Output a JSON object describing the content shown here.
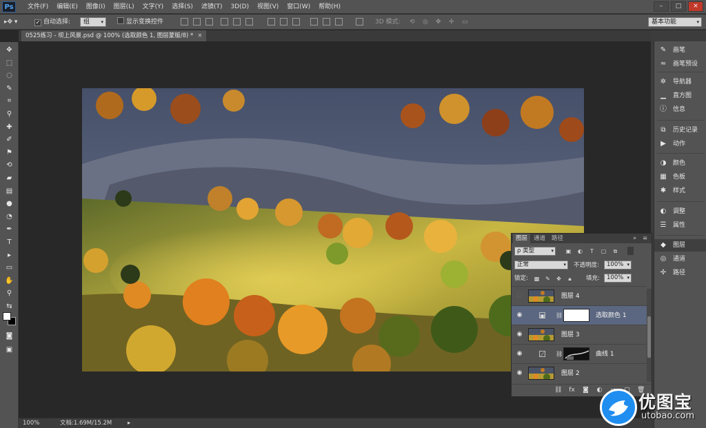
{
  "app": {
    "logo": "Ps"
  },
  "menu": [
    "文件(F)",
    "编辑(E)",
    "图像(I)",
    "图层(L)",
    "文字(Y)",
    "选择(S)",
    "滤镜(T)",
    "3D(D)",
    "视图(V)",
    "窗口(W)",
    "帮助(H)"
  ],
  "window_controls": {
    "minimize": "–",
    "maximize": "□",
    "close": "×"
  },
  "options": {
    "auto_select_label": "自动选择:",
    "auto_select_value": "组",
    "show_transform_label": "显示变换控件",
    "mode3d_label": "3D 模式:",
    "workspace": "基本功能"
  },
  "document": {
    "tab_title": "0525练习 - 坝上风景.psd @ 100% (选取颜色 1, 图层蒙版/8) *",
    "close": "×"
  },
  "status": {
    "zoom": "100%",
    "doc_size": "文档:1.69M/15.2M",
    "arrow": "▸"
  },
  "dock": [
    {
      "label": "画笔",
      "icon": "brush-icon",
      "glyph": "✎"
    },
    {
      "label": "画笔预设",
      "icon": "brush-presets-icon",
      "glyph": "≈"
    },
    {
      "label": "导航器",
      "icon": "navigator-icon",
      "glyph": "✲"
    },
    {
      "label": "直方图",
      "icon": "histogram-icon",
      "glyph": "▁"
    },
    {
      "label": "信息",
      "icon": "info-icon",
      "glyph": "ⓘ"
    },
    {
      "label": "历史记录",
      "icon": "history-icon",
      "glyph": "⧉"
    },
    {
      "label": "动作",
      "icon": "actions-icon",
      "glyph": "▶"
    },
    {
      "label": "颜色",
      "icon": "color-icon",
      "glyph": "◑"
    },
    {
      "label": "色板",
      "icon": "swatches-icon",
      "glyph": "▦"
    },
    {
      "label": "样式",
      "icon": "styles-icon",
      "glyph": "✱"
    },
    {
      "label": "调整",
      "icon": "adjustments-icon",
      "glyph": "◐"
    },
    {
      "label": "属性",
      "icon": "properties-icon",
      "glyph": "☰"
    },
    {
      "label": "图层",
      "icon": "layers-icon",
      "glyph": "◆"
    },
    {
      "label": "通道",
      "icon": "channels-icon",
      "glyph": "◎"
    },
    {
      "label": "路径",
      "icon": "paths-icon",
      "glyph": "✢"
    }
  ],
  "layers_panel": {
    "tabs": [
      "图层",
      "通道",
      "路径"
    ],
    "filter": "ρ 类型",
    "blend_mode": "正常",
    "opacity_label": "不透明度:",
    "opacity_value": "100%",
    "lock_label": "锁定:",
    "fill_label": "填充:",
    "fill_value": "100%",
    "layers": [
      {
        "name": "图层 4",
        "visible": false,
        "type": "pixel"
      },
      {
        "name": "选取颜色 1",
        "visible": true,
        "type": "adjustment",
        "selected": true
      },
      {
        "name": "图层 3",
        "visible": true,
        "type": "pixel"
      },
      {
        "name": "曲线 1",
        "visible": true,
        "type": "curves"
      },
      {
        "name": "图层 2",
        "visible": true,
        "type": "pixel"
      }
    ]
  },
  "watermark": {
    "title": "优图宝",
    "url": "utobao.com"
  },
  "colors": {
    "accent": "#1f8ef0",
    "chrome": "#535353",
    "canvas_bg": "#282828",
    "selected_layer": "#5b6780"
  }
}
